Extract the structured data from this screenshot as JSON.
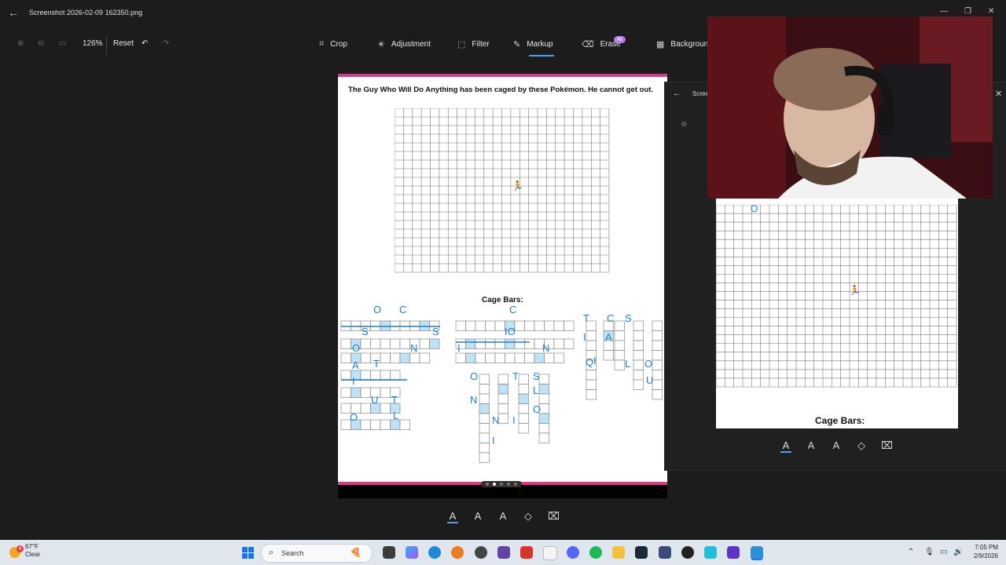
{
  "window": {
    "title": "Screenshot 2026-02-09 162350.png"
  },
  "toolbar": {
    "zoom": "126%",
    "reset": "Reset",
    "items": [
      {
        "icon": "crop-icon",
        "label": "Crop"
      },
      {
        "icon": "adjustment-icon",
        "label": "Adjustment"
      },
      {
        "icon": "filter-icon",
        "label": "Filter"
      },
      {
        "icon": "markup-icon",
        "label": "Markup"
      },
      {
        "icon": "erase-icon",
        "label": "Erase"
      },
      {
        "icon": "background-icon",
        "label": "Background"
      }
    ],
    "ai_badge": "AI",
    "active_item": "Markup"
  },
  "document": {
    "heading": "The Guy Who Will Do Anything has been caged by these Pokémon. He cannot get out.",
    "section_label": "Cage Bars:",
    "handwritten_letters": [
      "O",
      "C",
      "S",
      "S",
      "O",
      "N",
      "A",
      "T",
      "I",
      "U",
      "T",
      "O",
      "L",
      "L",
      "C",
      "IO",
      "I",
      "N",
      "T",
      "C",
      "S",
      "I",
      "A",
      "I",
      "Q",
      "L",
      "O",
      "U",
      "O",
      "T",
      "S",
      "N",
      "L",
      "O",
      "N",
      "I",
      "I"
    ]
  },
  "panel": {
    "title": "Scree",
    "section_label": "Cage Bars:",
    "handwritten_letters": [
      "O"
    ]
  },
  "taskbar": {
    "weather_temp": "67°F",
    "weather_desc": "Clear",
    "notification_count": "4",
    "search_placeholder": "Search",
    "time": "7:05 PM",
    "date": "2/9/2026"
  },
  "colors": {
    "accent": "#4aa3f0",
    "doc_border": "#d83a8a",
    "ink": "#1e7fd1",
    "cell_fill": "#bfe3f5"
  }
}
